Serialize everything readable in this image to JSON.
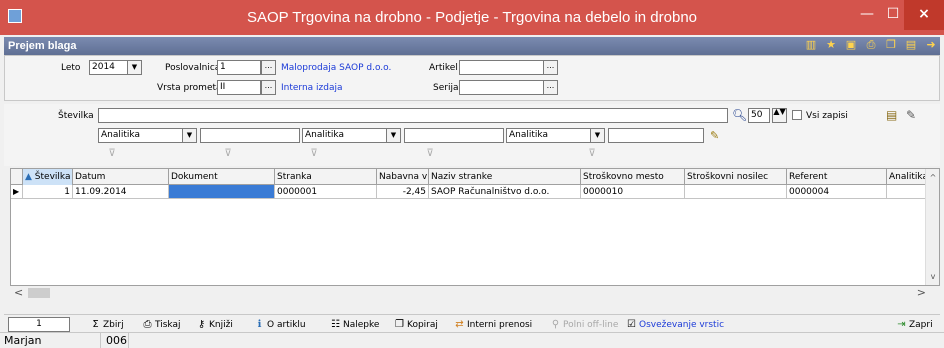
{
  "window": {
    "title": "SAOP Trgovina na drobno - Podjetje - Trgovina na debelo in drobno",
    "minimize": "—",
    "maximize": "☐",
    "close": "×"
  },
  "subheader": {
    "label": "Prejem blaga"
  },
  "form": {
    "leto_label": "Leto",
    "leto_value": "2014",
    "poslovalnica_label": "Poslovalnica",
    "poslovalnica_value": "1",
    "poslovalnica_link": "Maloprodaja SAOP d.o.o.",
    "vrsta_label": "Vrsta prometa",
    "vrsta_value": "II",
    "vrsta_link": "Interna izdaja",
    "artikel_label": "Artikel",
    "artikel_value": "",
    "serija_label": "Serija",
    "serija_value": "",
    "dots": "..."
  },
  "search": {
    "stevilka_label": "Številka",
    "stevilka_value": "",
    "count_value": "50",
    "vsi_label": "Vsi zapisi",
    "analitika1": "Analitika",
    "analitika2": "Analitika",
    "analitika3": "Analitika"
  },
  "grid": {
    "headers": [
      "Številka",
      "Datum",
      "Dokument",
      "Stranka",
      "Nabavna vr.",
      "Naziv stranke",
      "Stroškovno mesto",
      "Stroškovni nosilec",
      "Referent",
      "Analitika"
    ],
    "rows": [
      [
        "1",
        "11.09.2014",
        "",
        "0000001",
        "-2,45",
        "SAOP Računalništvo d.o.o.",
        "0000010",
        "",
        "0000004",
        ""
      ]
    ]
  },
  "status": {
    "count": "1",
    "zbirj": "Zbirj",
    "tiskaj": "Tiskaj",
    "knjizi": "Knjiži",
    "o_artiklu": "O artiklu",
    "nalepke": "Nalepke",
    "kopiraj": "Kopiraj",
    "interni": "Interni prenosi",
    "polni": "Polni off-line",
    "osvezevanje": "Osveževanje vrstic",
    "zapri": "Zapri"
  },
  "footer": {
    "user": "Marjan",
    "code": "006"
  },
  "colors": {
    "titlebar": "#d4544c",
    "subheader": "#6b7ba2",
    "link": "#1c3bd8",
    "selection": "#3a7bd5"
  }
}
